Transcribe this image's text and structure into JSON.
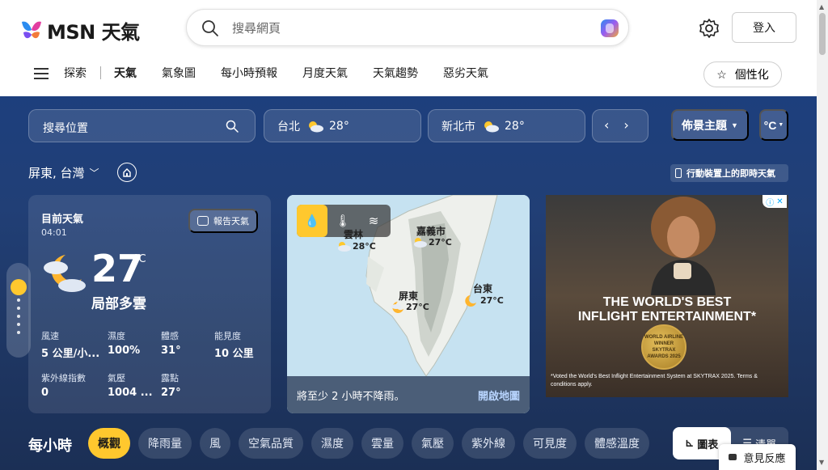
{
  "header": {
    "logo_text": "MSN 天氣",
    "search_placeholder": "搜尋網頁",
    "login_label": "登入"
  },
  "nav": {
    "items": [
      "探索",
      "天氣",
      "氣象圖",
      "每小時預報",
      "月度天氣",
      "天氣趨勢",
      "惡劣天氣"
    ],
    "active": "天氣",
    "personalize_label": "個性化"
  },
  "toolbar": {
    "location_search_placeholder": "搜尋位置",
    "cities": [
      {
        "name": "台北",
        "temp": "28°"
      },
      {
        "name": "新北市",
        "temp": "28°"
      }
    ],
    "theme_label": "佈景主題",
    "unit_label": "°C"
  },
  "location": {
    "title": "屏東, 台灣",
    "mobile_link": "行動裝置上的即時天氣"
  },
  "current": {
    "label": "目前天氣",
    "time": "04:01",
    "report_label": "報告天氣",
    "temp": "27",
    "unit": "°C",
    "condition": "局部多雲",
    "stats": [
      {
        "label": "風速",
        "value": "5 公里/小..."
      },
      {
        "label": "濕度",
        "value": "100%"
      },
      {
        "label": "體感",
        "value": "31°"
      },
      {
        "label": "能見度",
        "value": "10 公里"
      },
      {
        "label": "紫外線指數",
        "value": "0"
      },
      {
        "label": "氣壓",
        "value": "1004 ..."
      },
      {
        "label": "露點",
        "value": "27°"
      }
    ]
  },
  "map": {
    "labels": [
      {
        "name": "雲林",
        "temp": "28°C"
      },
      {
        "name": "嘉義市",
        "temp": "27°C"
      },
      {
        "name": "屏東",
        "temp": "27°C"
      },
      {
        "name": "台東",
        "temp": "27°C"
      }
    ],
    "footer_text": "將至少 2 小時不降雨。",
    "open_label": "開啟地圖"
  },
  "ad": {
    "headline_1": "THE WORLD'S BEST",
    "headline_2": "INFLIGHT ENTERTAINMENT*",
    "badge_1": "WORLD AIRLINE",
    "badge_2": "WINNER",
    "badge_3": "SKYTRAX",
    "badge_4": "AWARDS 2025",
    "fine_print": "*Voted the World's Best Inflight Entertainment System at SKYTRAX 2025. Terms & conditions apply."
  },
  "hourly": {
    "title": "每小時",
    "chips": [
      "概觀",
      "降雨量",
      "風",
      "空氣品質",
      "濕度",
      "雲量",
      "氣壓",
      "紫外線",
      "可見度",
      "體感溫度"
    ],
    "active_chip": "概觀",
    "view_chart": "圖表",
    "view_list": "清單"
  },
  "feedback_label": "意見反應",
  "colors": {
    "accent": "#ffc82e",
    "main_bg": "#1f3a6e"
  }
}
